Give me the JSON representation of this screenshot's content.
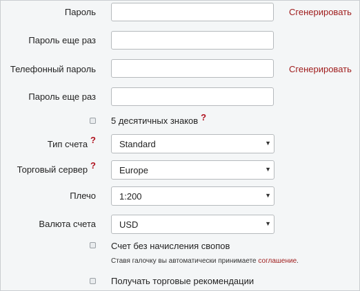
{
  "form": {
    "password": {
      "label": "Пароль",
      "value": "",
      "generate": "Сгенерировать"
    },
    "password_repeat": {
      "label": "Пароль еще раз",
      "value": ""
    },
    "phone_password": {
      "label": "Телефонный пароль",
      "value": "",
      "generate": "Сгенерировать"
    },
    "phone_password_repeat": {
      "label": "Пароль еще раз",
      "value": ""
    },
    "five_digits": {
      "label": "5 десятичных знаков",
      "help": "?",
      "checked": false
    },
    "account_type": {
      "label": "Тип счета",
      "help": "?",
      "value": "Standard"
    },
    "server": {
      "label": "Торговый сервер",
      "help": "?",
      "value": "Europe"
    },
    "leverage": {
      "label": "Плечо",
      "value": "1:200"
    },
    "currency": {
      "label": "Валюта счета",
      "value": "USD"
    },
    "swap_free": {
      "label": "Счет без начисления свопов",
      "checked": false,
      "note_prefix": "Ставя галочку вы автоматически принимаете ",
      "note_link": "соглашение",
      "note_suffix": "."
    },
    "recommendations": {
      "label": "Получать торговые рекомендации",
      "checked": false
    }
  },
  "icons": {
    "dropdown": "chevron-down-icon"
  },
  "colors": {
    "accent": "#9e1a1a",
    "help": "#b0121f"
  }
}
